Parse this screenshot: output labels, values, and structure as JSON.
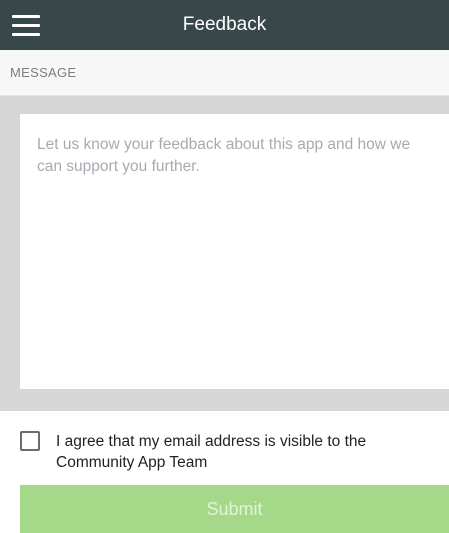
{
  "header": {
    "title": "Feedback",
    "menu_icon": "hamburger-menu-icon"
  },
  "section": {
    "label": "MESSAGE"
  },
  "message": {
    "value": "",
    "placeholder": "Let us know your feedback about this app and how we can support you further."
  },
  "agreement": {
    "checked": false,
    "label": "I agree that my email address is visible to the Community App Team"
  },
  "submit": {
    "label": "Submit",
    "enabled": false
  },
  "colors": {
    "topbar": "#37474a",
    "submit_disabled": "#a6d88a",
    "textarea_frame": "#d6d6d6"
  }
}
